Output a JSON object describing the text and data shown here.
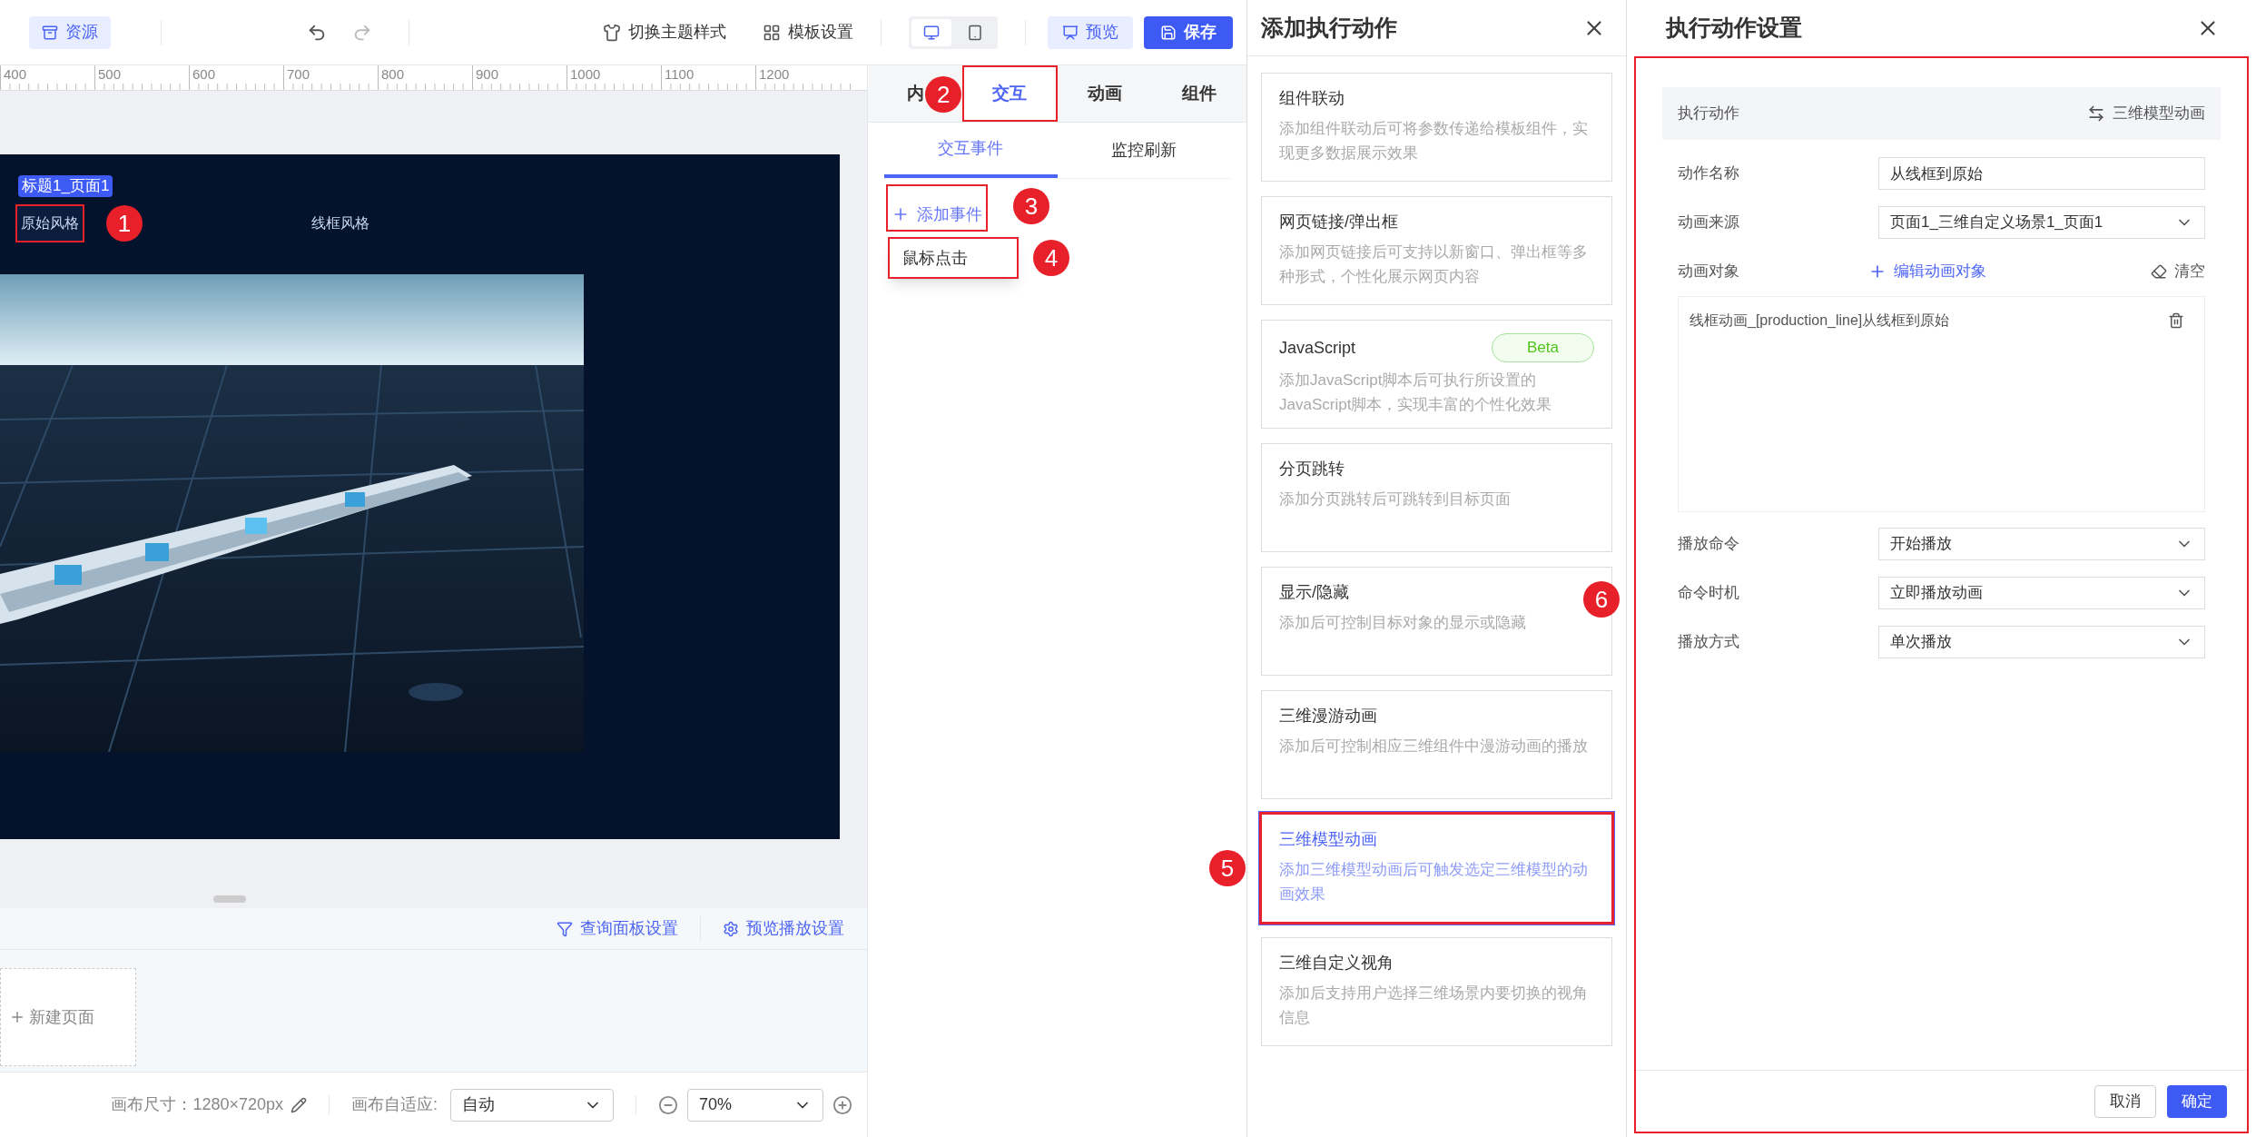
{
  "toolbar": {
    "resource_button": "资源",
    "theme_button": "切换主题样式",
    "template_button": "模板设置",
    "devices": [
      {
        "kind": "desktop",
        "selected": true
      },
      {
        "kind": "mobile",
        "selected": false
      }
    ],
    "preview_button": "预览",
    "save_button": "保存"
  },
  "ruler": {
    "ticks": [
      "400",
      "500",
      "600",
      "700",
      "800",
      "900",
      "1000",
      "1100",
      "1200"
    ]
  },
  "canvas": {
    "title_tag": "标题1_页面1",
    "style_buttons": [
      {
        "label": "原始风格",
        "selected": true,
        "highlighted": true,
        "marker": "1"
      },
      {
        "label": "线框风格",
        "selected": false,
        "highlighted": false
      }
    ]
  },
  "bottom_bar": {
    "links": [
      {
        "kind": "filter",
        "label": "查询面板设置"
      },
      {
        "kind": "settings",
        "label": "预览播放设置"
      }
    ],
    "new_page": "新建页面"
  },
  "status_bar": {
    "canvas_size": "画布尺寸：1280×720px",
    "fit_label": "画布自适应:",
    "fit_value": "自动",
    "zoom_value": "70%"
  },
  "properties_panel": {
    "tabs": [
      {
        "label": "内",
        "selected": false,
        "highlighted": false
      },
      {
        "label": "交互",
        "selected": true,
        "highlighted": true,
        "marker": "2"
      },
      {
        "label": "动画",
        "selected": false,
        "highlighted": false
      },
      {
        "label": "组件",
        "selected": false,
        "highlighted": false
      }
    ],
    "sub_tabs": [
      {
        "label": "交互事件",
        "selected": true
      },
      {
        "label": "监控刷新",
        "selected": false
      }
    ],
    "add_event": {
      "label": "添加事件",
      "highlighted": true,
      "marker": "3"
    },
    "event_menu": [
      {
        "label": "鼠标点击",
        "highlighted": true,
        "marker": "4"
      }
    ]
  },
  "add_action_panel": {
    "title": "添加执行动作",
    "cards": [
      {
        "title": "组件联动",
        "description": "添加组件联动后可将参数传递给模板组件，实现更多数据展示效果",
        "selected": false,
        "highlighted": false
      },
      {
        "title": "网页链接/弹出框",
        "description": "添加网页链接后可支持以新窗口、弹出框等多种形式，个性化展示网页内容",
        "selected": false,
        "highlighted": false
      },
      {
        "title": "JavaScript",
        "badge": "Beta",
        "description": "添加JavaScript脚本后可执行所设置的JavaScript脚本，实现丰富的个性化效果",
        "selected": false,
        "highlighted": false
      },
      {
        "title": "分页跳转",
        "description": "添加分页跳转后可跳转到目标页面",
        "selected": false,
        "highlighted": false
      },
      {
        "title": "显示/隐藏",
        "description": "添加后可控制目标对象的显示或隐藏",
        "selected": false,
        "highlighted": false
      },
      {
        "title": "三维漫游动画",
        "description": "添加后可控制相应三维组件中漫游动画的播放",
        "selected": false,
        "highlighted": false
      },
      {
        "title": "三维模型动画",
        "description": "添加三维模型动画后可触发选定三维模型的动画效果",
        "selected": true,
        "highlighted": true,
        "marker": "5"
      },
      {
        "title": "三维自定义视角",
        "description": "添加后支持用户选择三维场景内要切换的视角信息",
        "selected": false,
        "highlighted": false
      }
    ]
  },
  "settings_panel": {
    "title": "执行动作设置",
    "highlighted": true,
    "marker": "6",
    "action": {
      "label": "执行动作",
      "value": "三维模型动画"
    },
    "fields": [
      {
        "kind": "input",
        "label": "动作名称",
        "value": "从线框到原始"
      },
      {
        "kind": "select",
        "label": "动画来源",
        "value": "页面1_三维自定义场景1_页面1"
      }
    ],
    "animation_object": {
      "label": "动画对象",
      "edit_link": "编辑动画对象",
      "clear_button": "清空",
      "items": [
        "线框动画_[production_line]从线框到原始"
      ]
    },
    "play_fields": [
      {
        "kind": "select",
        "label": "播放命令",
        "value": "开始播放"
      },
      {
        "kind": "select",
        "label": "命令时机",
        "value": "立即播放动画"
      },
      {
        "kind": "select",
        "label": "播放方式",
        "value": "单次播放"
      }
    ],
    "buttons": {
      "cancel": "取消",
      "confirm": "确定"
    }
  }
}
